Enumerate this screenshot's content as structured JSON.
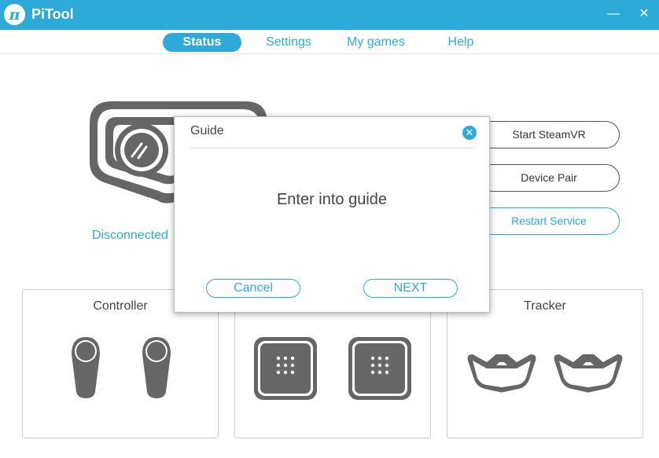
{
  "app": {
    "title": "PiTool",
    "logo_glyph": "π",
    "accent": "#2eaad9"
  },
  "window": {
    "minimize_glyph": "—",
    "close_glyph": "✕"
  },
  "nav": {
    "items": [
      {
        "label": "Status",
        "active": true
      },
      {
        "label": "Settings",
        "active": false
      },
      {
        "label": "My games",
        "active": false
      },
      {
        "label": "Help",
        "active": false
      }
    ]
  },
  "headset": {
    "status": "Disconnected",
    "icon": "vr-headset-icon"
  },
  "actions": {
    "start_steamvr": "Start SteamVR",
    "device_pair": "Device Pair",
    "restart_service": "Restart Service"
  },
  "panels": {
    "controller": {
      "title": "Controller",
      "icon": "controller-icon"
    },
    "base_station": {
      "icon": "base-station-icon"
    },
    "tracker": {
      "title": "Tracker",
      "icon": "tracker-icon"
    }
  },
  "dialog": {
    "title": "Guide",
    "message": "Enter into guide",
    "cancel": "Cancel",
    "next": "NEXT",
    "close_glyph": "✕"
  }
}
